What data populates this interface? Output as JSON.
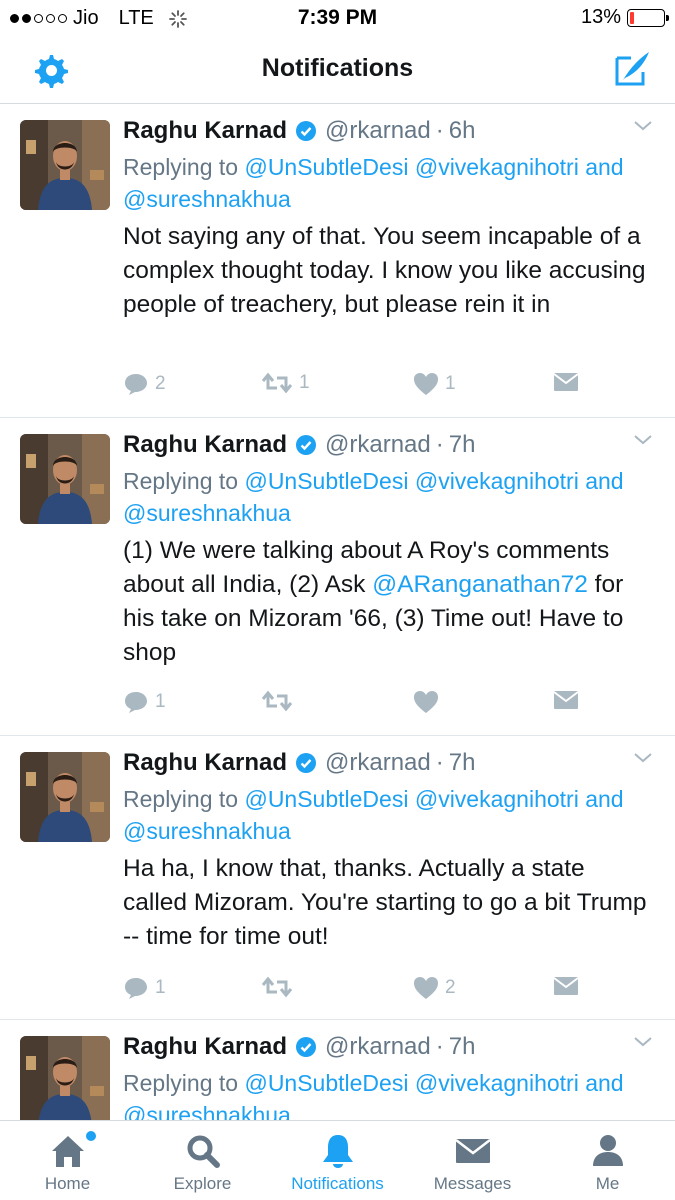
{
  "status_bar": {
    "carrier": "Jio",
    "network": "LTE",
    "time": "7:39 PM",
    "battery": "13%",
    "battery_level": 0.13
  },
  "header": {
    "title": "Notifications",
    "settings_icon": "gear-icon",
    "compose_icon": "compose-icon"
  },
  "tweets": [
    {
      "name": "Raghu Karnad",
      "handle": "@rkarnad",
      "time": "6h",
      "replying_prefix": "Replying to ",
      "mention1": "@UnSubtleDesi",
      "mention2": "@vivekagnihotri",
      "and": " and",
      "mention3": "@sureshnakhua",
      "text": "Not saying any of that. You seem incapable of a complex thought today. I know you like accusing people of treachery, but please rein it in",
      "replies": "2",
      "retweets": "1",
      "likes": "1"
    },
    {
      "name": "Raghu Karnad",
      "handle": "@rkarnad",
      "time": "7h",
      "replying_prefix": "Replying to ",
      "mention1": "@UnSubtleDesi",
      "mention2": "@vivekagnihotri",
      "and": " and",
      "mention3": "@sureshnakhua",
      "text_a": "(1) We were talking about A Roy's comments about all India, (2) Ask ",
      "text_mention": "@ARanganathan72",
      "text_b": " for his take on Mizoram '66, (3) Time out! Have to shop",
      "replies": "1",
      "retweets": "",
      "likes": ""
    },
    {
      "name": "Raghu Karnad",
      "handle": "@rkarnad",
      "time": "7h",
      "replying_prefix": "Replying to ",
      "mention1": "@UnSubtleDesi",
      "mention2": "@vivekagnihotri",
      "and": " and",
      "mention3": "@sureshnakhua",
      "text": "Ha ha, I know that, thanks. Actually a state called Mizoram. You're starting to go a bit Trump -- time for time out!",
      "replies": "1",
      "retweets": "",
      "likes": "2"
    },
    {
      "name": "Raghu Karnad",
      "handle": "@rkarnad",
      "time": "7h",
      "replying_prefix": "Replying to ",
      "mention1": "@UnSubtleDesi",
      "mention2": "@vivekagnihotri",
      "and": " and",
      "mention3": "@sureshnakhua"
    }
  ],
  "tabs": [
    {
      "label": "Home",
      "icon": "home-icon"
    },
    {
      "label": "Explore",
      "icon": "search-icon"
    },
    {
      "label": "Notifications",
      "icon": "bell-icon"
    },
    {
      "label": "Messages",
      "icon": "envelope-icon"
    },
    {
      "label": "Me",
      "icon": "person-icon"
    }
  ],
  "colors": {
    "accent": "#1da1f2",
    "muted": "#657786",
    "action_gray": "#aab8c2",
    "battery_low": "#ff3b30"
  }
}
